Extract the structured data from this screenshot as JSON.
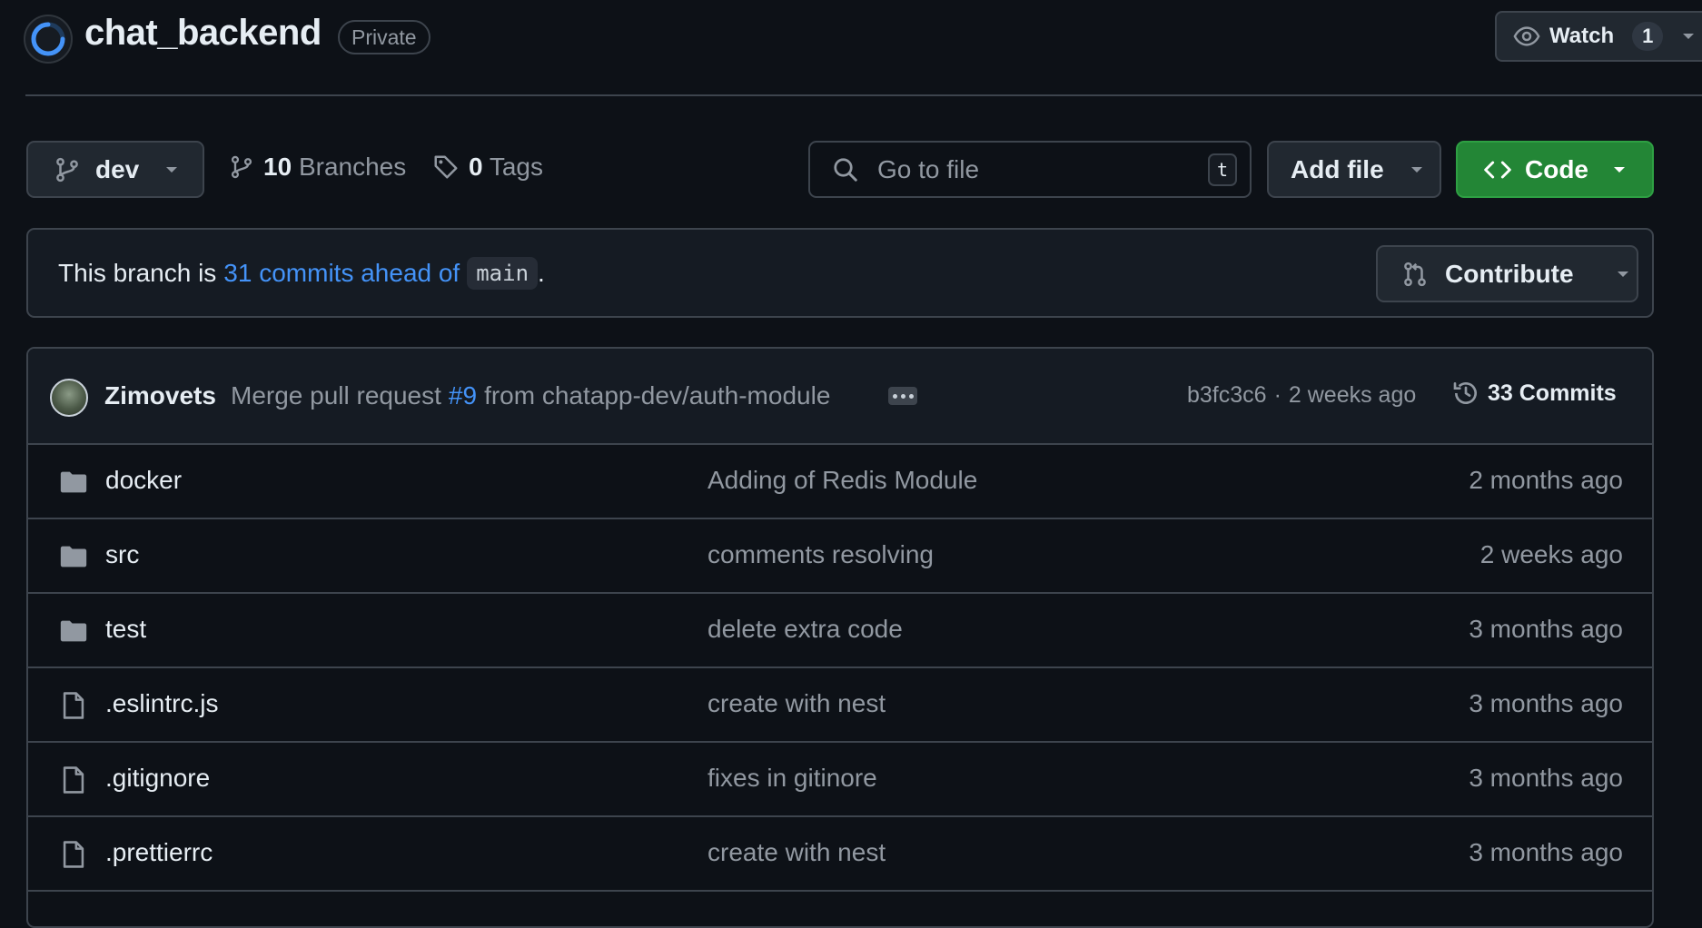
{
  "repo": {
    "name": "chat_backend",
    "visibility": "Private",
    "watch_label": "Watch",
    "watch_count": "1"
  },
  "toolbar": {
    "branch": "dev",
    "branches_count": "10",
    "branches_label": "Branches",
    "tags_count": "0",
    "tags_label": "Tags",
    "search_placeholder": "Go to file",
    "search_shortcut": "t",
    "add_file_label": "Add file",
    "code_label": "Code"
  },
  "branch_status": {
    "prefix": "This branch is",
    "ahead_link": "31 commits ahead of",
    "base_branch": "main",
    "suffix": ".",
    "contribute_label": "Contribute"
  },
  "latest_commit": {
    "author": "Zimovets",
    "message_prefix": "Merge pull request",
    "pr_link": "#9",
    "message_suffix": "from chatapp-dev/auth-module",
    "sha": "b3fc3c6",
    "separator": "·",
    "time": "2 weeks ago",
    "commits_label": "33 Commits"
  },
  "files": [
    {
      "type": "folder",
      "name": "docker",
      "message": "Adding of Redis Module",
      "date": "2 months ago"
    },
    {
      "type": "folder",
      "name": "src",
      "message": "comments resolving",
      "date": "2 weeks ago"
    },
    {
      "type": "folder",
      "name": "test",
      "message": "delete extra code",
      "date": "3 months ago"
    },
    {
      "type": "file",
      "name": ".eslintrc.js",
      "message": "create with nest",
      "date": "3 months ago"
    },
    {
      "type": "file",
      "name": ".gitignore",
      "message": "fixes in gitinore",
      "date": "3 months ago"
    },
    {
      "type": "file",
      "name": ".prettierrc",
      "message": "create with nest",
      "date": "3 months ago"
    }
  ],
  "colors": {
    "background": "#0d1117",
    "border": "#3d444d",
    "link": "#4493f8",
    "code_button": "#238636",
    "muted_text": "#9198a1"
  }
}
